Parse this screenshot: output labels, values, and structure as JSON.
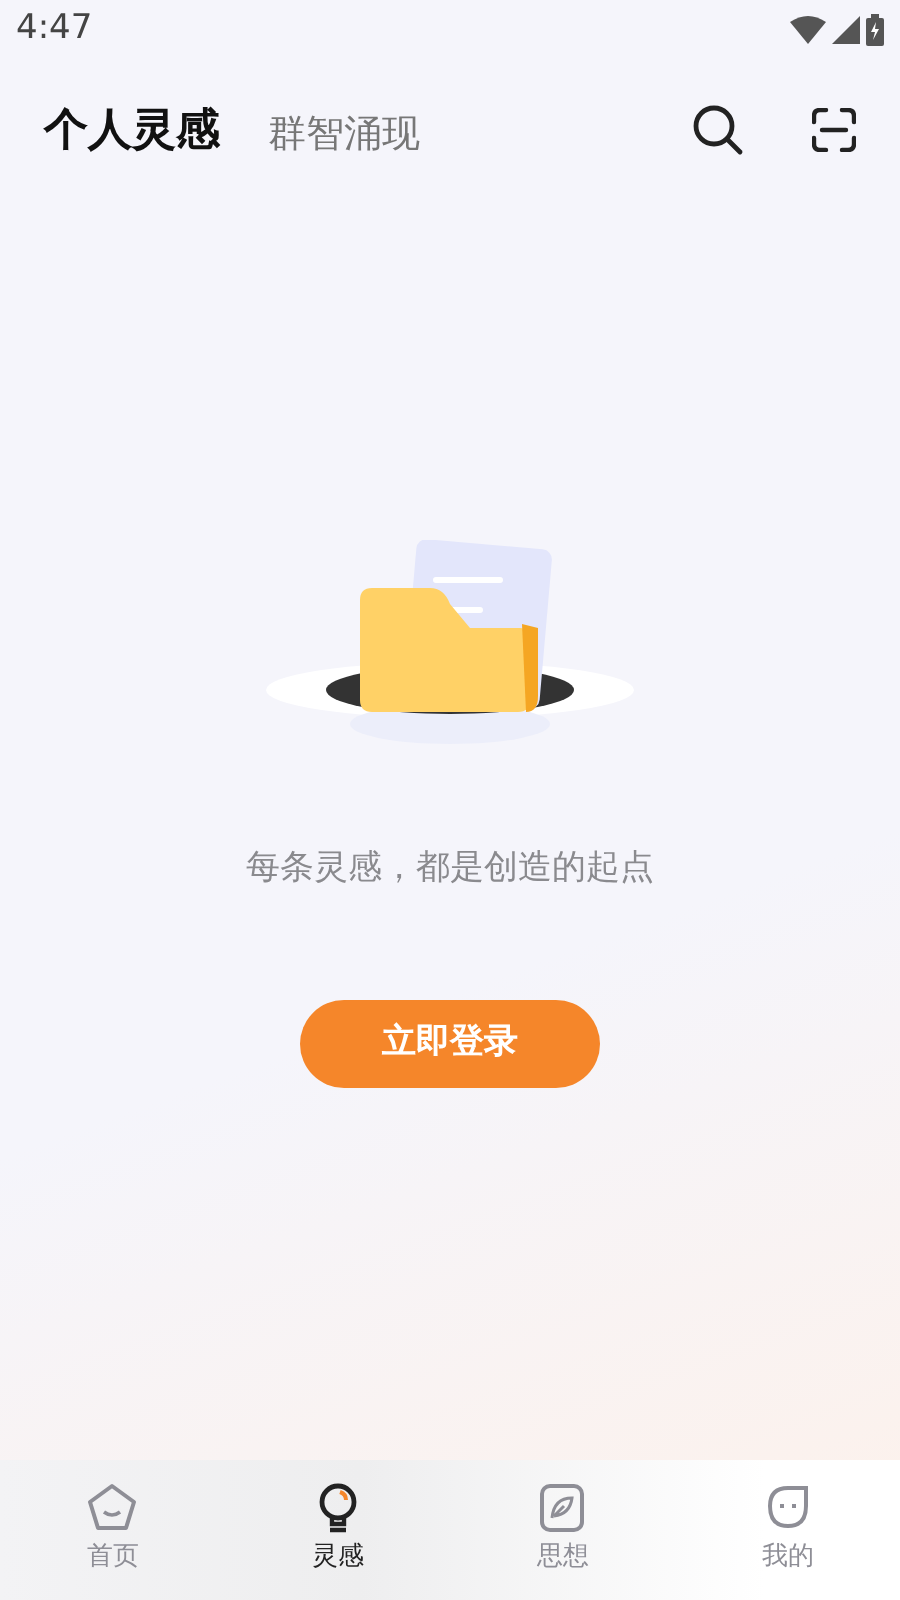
{
  "status_bar": {
    "time": "4:47"
  },
  "top_tabs": [
    {
      "label": "个人灵感",
      "selected": true
    },
    {
      "label": "群智涌现",
      "selected": false
    }
  ],
  "empty_state": {
    "message": "每条灵感，都是创造的起点",
    "button": "立即登录"
  },
  "bottom_nav": [
    {
      "label": "首页",
      "kind": "home",
      "selected": false
    },
    {
      "label": "灵感",
      "kind": "bulb",
      "selected": true
    },
    {
      "label": "思想",
      "kind": "leaf",
      "selected": false
    },
    {
      "label": "我的",
      "kind": "face",
      "selected": false
    }
  ]
}
